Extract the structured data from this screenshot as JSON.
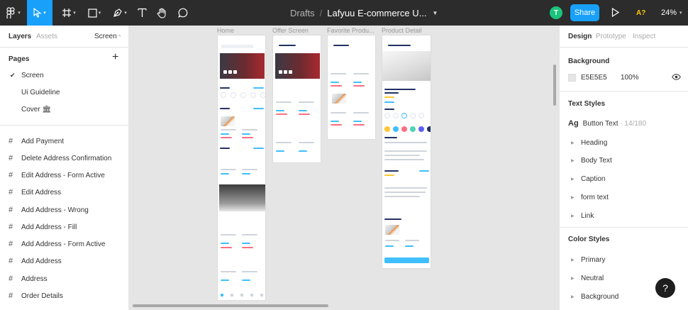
{
  "toolbar": {
    "drafts": "Drafts",
    "separator": "/",
    "file_name": "Lafyuu E-commerce U...",
    "avatar_initial": "T",
    "share_label": "Share",
    "assistant_label": "A?",
    "zoom_label": "24%",
    "accent": "#18a0fb",
    "avatar_color": "#1bc47d",
    "icons": [
      "figma-menu-icon",
      "move-tool-icon",
      "frame-tool-icon",
      "shape-tool-icon",
      "pen-tool-icon",
      "text-tool-icon",
      "hand-tool-icon",
      "comment-tool-icon",
      "play-icon"
    ]
  },
  "left_panel": {
    "tabs": {
      "layers": "Layers",
      "assets": "Assets"
    },
    "page_selector": "Screen",
    "pages_header": "Pages",
    "pages": [
      {
        "label": "Screen",
        "selected": true
      },
      {
        "label": "Ui Guideline",
        "selected": false
      },
      {
        "label": "Cover 🏛",
        "selected": false
      }
    ],
    "layers": [
      "Add Payment",
      "Delete Address Confirmation",
      "Edit Address - Form Active",
      "Edit Address",
      "Add Address - Wrong",
      "Add Address - Fill",
      "Add Address - Form Active",
      "Add Address",
      "Address",
      "Order Details"
    ]
  },
  "canvas": {
    "background": "#E5E5E5",
    "frames": [
      {
        "label": "Home"
      },
      {
        "label": "Offer Screen"
      },
      {
        "label": "Favorite Produ..."
      },
      {
        "label": "Product Detail"
      }
    ]
  },
  "right_panel": {
    "tabs": {
      "design": "Design",
      "prototype": "Prototype",
      "inspect": "Inspect"
    },
    "background_header": "Background",
    "background_hex": "E5E5E5",
    "background_opacity": "100%",
    "text_styles_header": "Text Styles",
    "text_style_active": {
      "prefix": "Ag",
      "name": "Button Text",
      "size": "· 14/180"
    },
    "text_styles": [
      "Heading",
      "Body Text",
      "Caption",
      "form text",
      "Link"
    ],
    "color_styles_header": "Color Styles",
    "color_styles": [
      "Primary",
      "Neutral",
      "Background"
    ]
  },
  "help_label": "?"
}
